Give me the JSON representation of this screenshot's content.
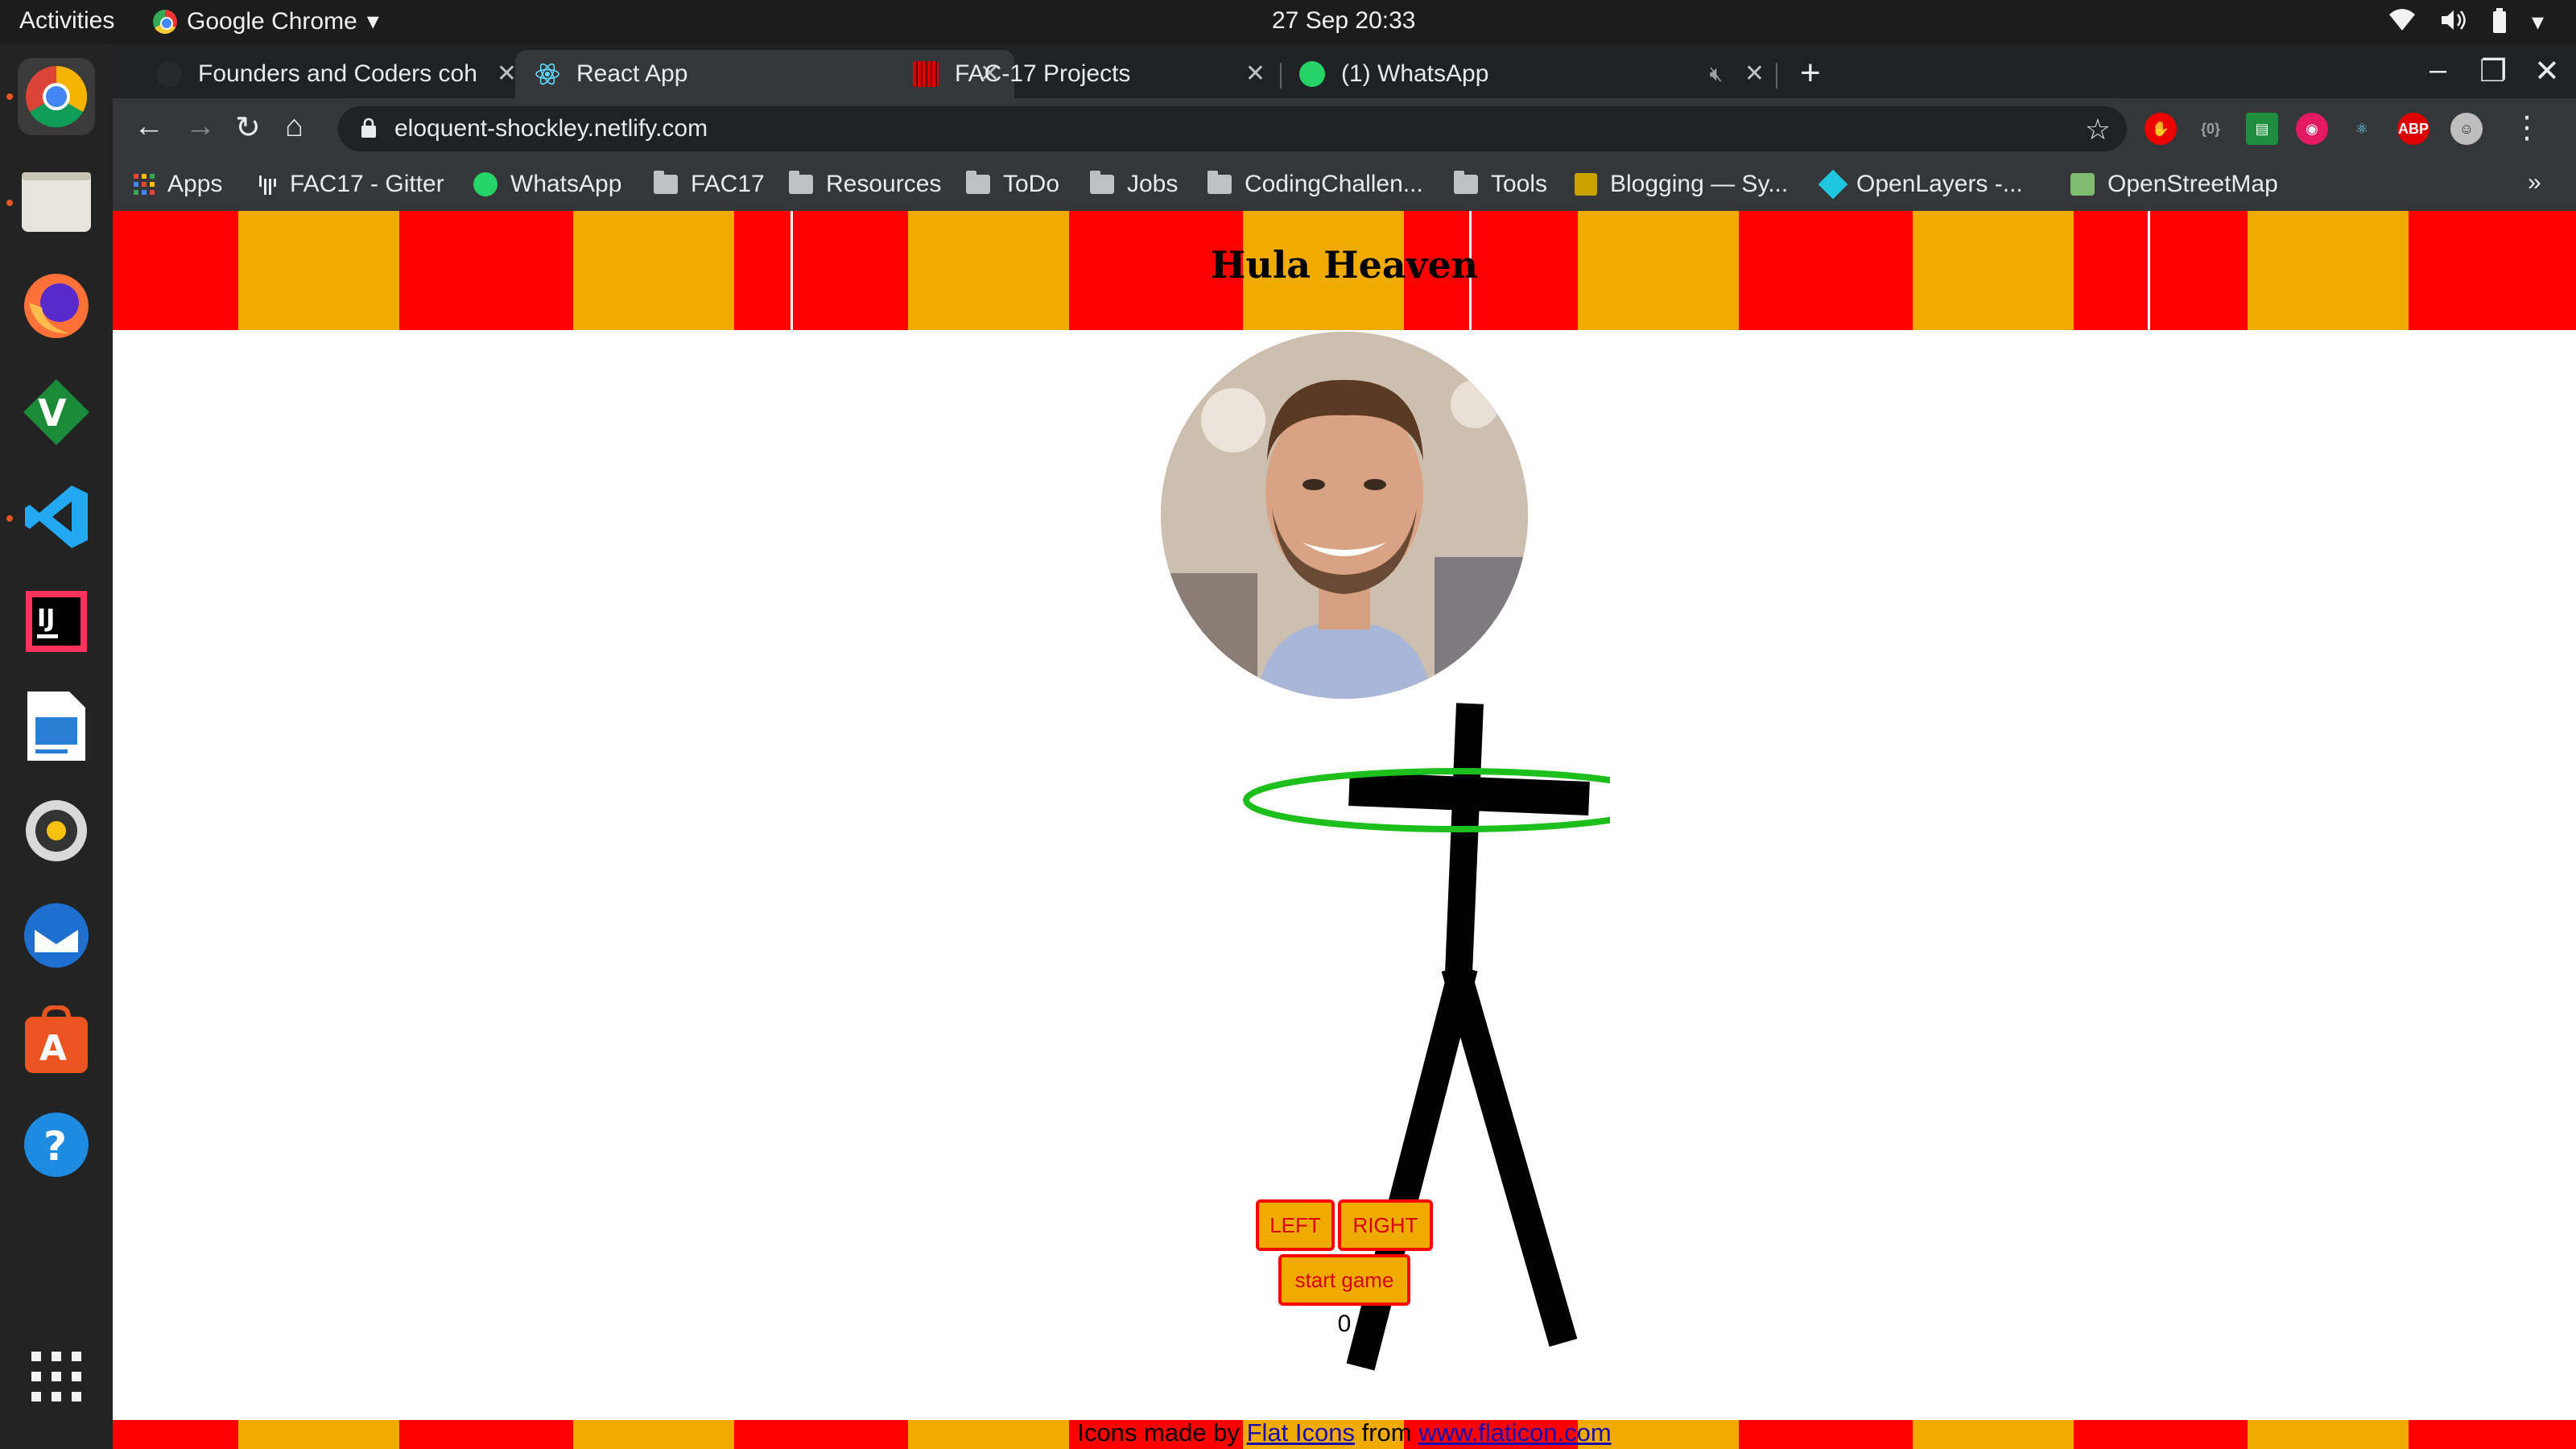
{
  "topbar": {
    "activities": "Activities",
    "app_name": "Google Chrome",
    "clock": "27 Sep  20:33"
  },
  "tabs": [
    {
      "title": "Founders and Coders coh",
      "active": false
    },
    {
      "title": "React App",
      "active": true
    },
    {
      "title": "FAC-17 Projects",
      "active": false
    },
    {
      "title": "(1) WhatsApp",
      "active": false
    }
  ],
  "omnibox": {
    "url": "eloquent-shockley.netlify.com"
  },
  "bookmarks": [
    {
      "label": "Apps",
      "icon": "apps-grid-icon"
    },
    {
      "label": "FAC17 - Gitter",
      "icon": "gitter-icon"
    },
    {
      "label": "WhatsApp",
      "icon": "whatsapp-icon"
    },
    {
      "label": "FAC17",
      "icon": "folder-icon"
    },
    {
      "label": "Resources",
      "icon": "folder-icon"
    },
    {
      "label": "ToDo",
      "icon": "folder-icon"
    },
    {
      "label": "Jobs",
      "icon": "folder-icon"
    },
    {
      "label": "CodingChallen...",
      "icon": "folder-icon"
    },
    {
      "label": "Tools",
      "icon": "folder-icon"
    },
    {
      "label": "Blogging — Sy...",
      "icon": "syndication-icon"
    },
    {
      "label": "OpenLayers -...",
      "icon": "openlayers-icon"
    },
    {
      "label": "OpenStreetMap",
      "icon": "openstreetmap-icon"
    }
  ],
  "page": {
    "title": "Hula Heaven",
    "buttons": {
      "left": "LEFT",
      "right": "RIGHT",
      "start": "start game"
    },
    "score": "0",
    "credit": {
      "prefix": "Icons made by",
      "link1": "Flat Icons",
      "middle": "from",
      "link2": "www.flaticon.com"
    }
  },
  "colors": {
    "stripe_red": "#ff0000",
    "stripe_yellow": "#f0ab00",
    "hoop": "#1dbf1d"
  }
}
